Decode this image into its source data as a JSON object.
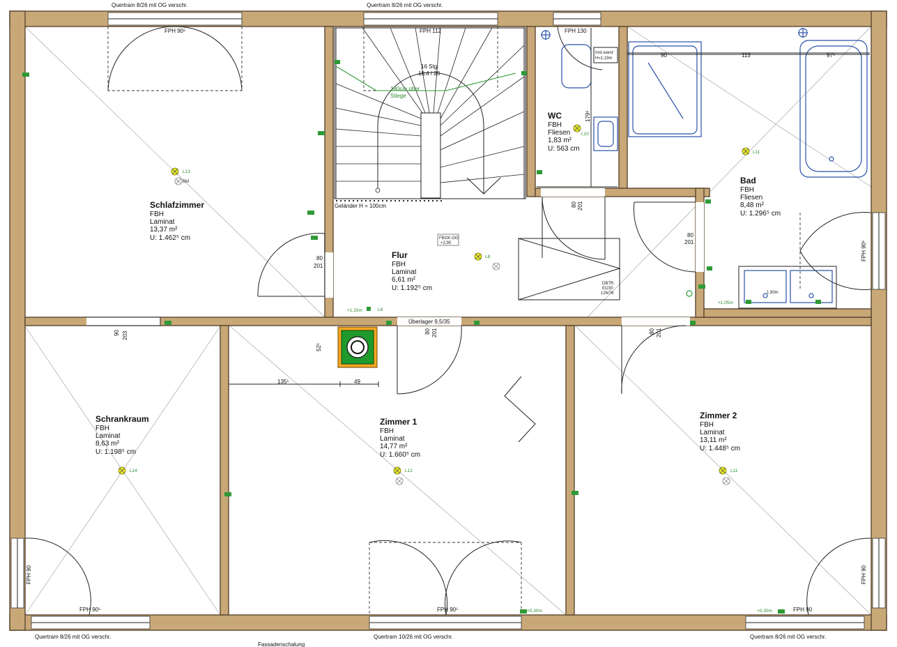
{
  "rooms": {
    "schlafzimmer": {
      "name": "Schlafzimmer",
      "heating": "FBH",
      "floor": "Laminat",
      "area": "13,37 m²",
      "perimeter": "U: 1.462⁵ cm"
    },
    "flur": {
      "name": "Flur",
      "heating": "FBH",
      "floor": "Laminat",
      "area": "6,61 m²",
      "perimeter": "U: 1.192⁵ cm"
    },
    "wc": {
      "name": "WC",
      "heating": "FBH",
      "floor": "Fliesen",
      "area": "1,83 m²",
      "perimeter": "U: 563 cm"
    },
    "bad": {
      "name": "Bad",
      "heating": "FBH",
      "floor": "Fliesen",
      "area": "8,48 m²",
      "perimeter": "U: 1.296⁵ cm"
    },
    "schrankraum": {
      "name": "Schrankraum",
      "heating": "FBH",
      "floor": "Laminat",
      "area": "8,63 m²",
      "perimeter": "U: 1.198⁵ cm"
    },
    "zimmer1": {
      "name": "Zimmer 1",
      "heating": "FBH",
      "floor": "Laminat",
      "area": "14,77 m²",
      "perimeter": "U: 1.660⁵ cm"
    },
    "zimmer2": {
      "name": "Zimmer 2",
      "heating": "FBH",
      "floor": "Laminat",
      "area": "13,11 m²",
      "perimeter": "U: 1.448⁵ cm"
    }
  },
  "lintels": {
    "top_left": "Quertram 8/26 mit OG verschr.",
    "top_mid": "Quertram 8/26 mit OG verschr.",
    "bottom_left": "Quertram 8/26 mit OG verschr.",
    "bottom_mid": "Quertram 10/26 mit OG verschr.",
    "bottom_right": "Quertram 8/26 mit OG verschr.",
    "facade": "Fassadenschalung"
  },
  "windows": {
    "fph_top_left": "FPH 90⁵",
    "fph_top_mid": "FPH 112",
    "fph_wc": "FPH 130",
    "fph_bad_right": "FPH 90⁵",
    "fph_left_side": "FPH 90",
    "fph_bottom_left": "FPH 90⁵",
    "fph_bottom_mid": "FPH 90⁵",
    "fph_bottom_right": "FPH 90",
    "fph_right_side": "FPH 90"
  },
  "stairs": {
    "steps": "16 Stg.",
    "ratio": "18,4 / 28",
    "clearance": "180cm über",
    "clearance2": "Stiege",
    "railing": "Geländer H = 100cm",
    "box_code": "FBOK-OG",
    "box_level": "+2,95"
  },
  "dimensions": {
    "d90": "90",
    "d113": "113",
    "d975": "97⁵",
    "d1795": "179⁵",
    "wc_door_w": "80",
    "wc_door_h": "201",
    "bad_door_w": "80",
    "bad_door_h": "201",
    "flur_door_w": "80",
    "flur_door_h": "201",
    "schrank_door_w": "90",
    "schrank_door_h": "203",
    "z1_door_w": "80",
    "z1_door_h": "201",
    "z2_door_w": "80",
    "z2_door_h": "201",
    "chimney_dim": "52⁵",
    "d1355": "135⁵",
    "d49": "49",
    "beam": "Überlager 9,5/35"
  },
  "annotations": {
    "installwand": "Inst.wand",
    "installwand_h": "H=1,19m",
    "dbtr": "DBTR.",
    "dbtr_code": "EI230",
    "dbtr_size": "126/76",
    "h115": "+1,15m",
    "h030": "+0,30m",
    "h105": "+1,05m",
    "h090": "1,90m"
  },
  "lamps": {
    "l13": "L13",
    "l10": "L10",
    "l11": "L11",
    "l8": "L8",
    "l6": "L6",
    "l14": "L14",
    "l12": "L12",
    "l11b": "L11",
    "bm": "BM"
  }
}
